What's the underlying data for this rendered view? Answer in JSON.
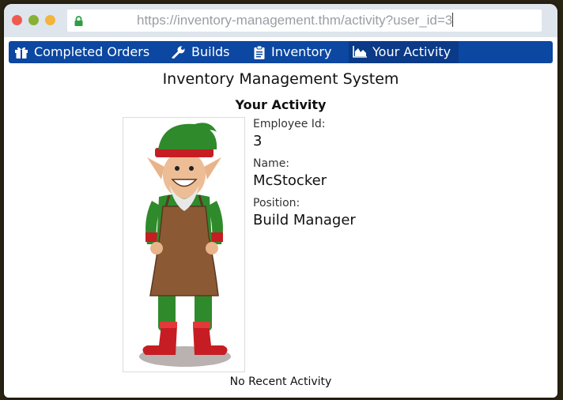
{
  "browser": {
    "url": "https://inventory-management.thm/activity?user_id=3"
  },
  "nav": {
    "items": [
      {
        "label": "Completed Orders",
        "icon": "gift-icon"
      },
      {
        "label": "Builds",
        "icon": "wrench-icon"
      },
      {
        "label": "Inventory",
        "icon": "clipboard-icon"
      },
      {
        "label": "Your Activity",
        "icon": "area-chart-icon",
        "active": true
      }
    ]
  },
  "page": {
    "title": "Inventory Management System",
    "section_title": "Your Activity"
  },
  "employee": {
    "id_label": "Employee Id:",
    "id_value": "3",
    "name_label": "Name:",
    "name_value": "McStocker",
    "position_label": "Position:",
    "position_value": "Build Manager"
  },
  "activity": {
    "empty_text": "No Recent Activity"
  },
  "colors": {
    "nav_bg": "#0c47a1",
    "nav_active": "#0a3a88",
    "lock_green": "#2e9e44"
  }
}
